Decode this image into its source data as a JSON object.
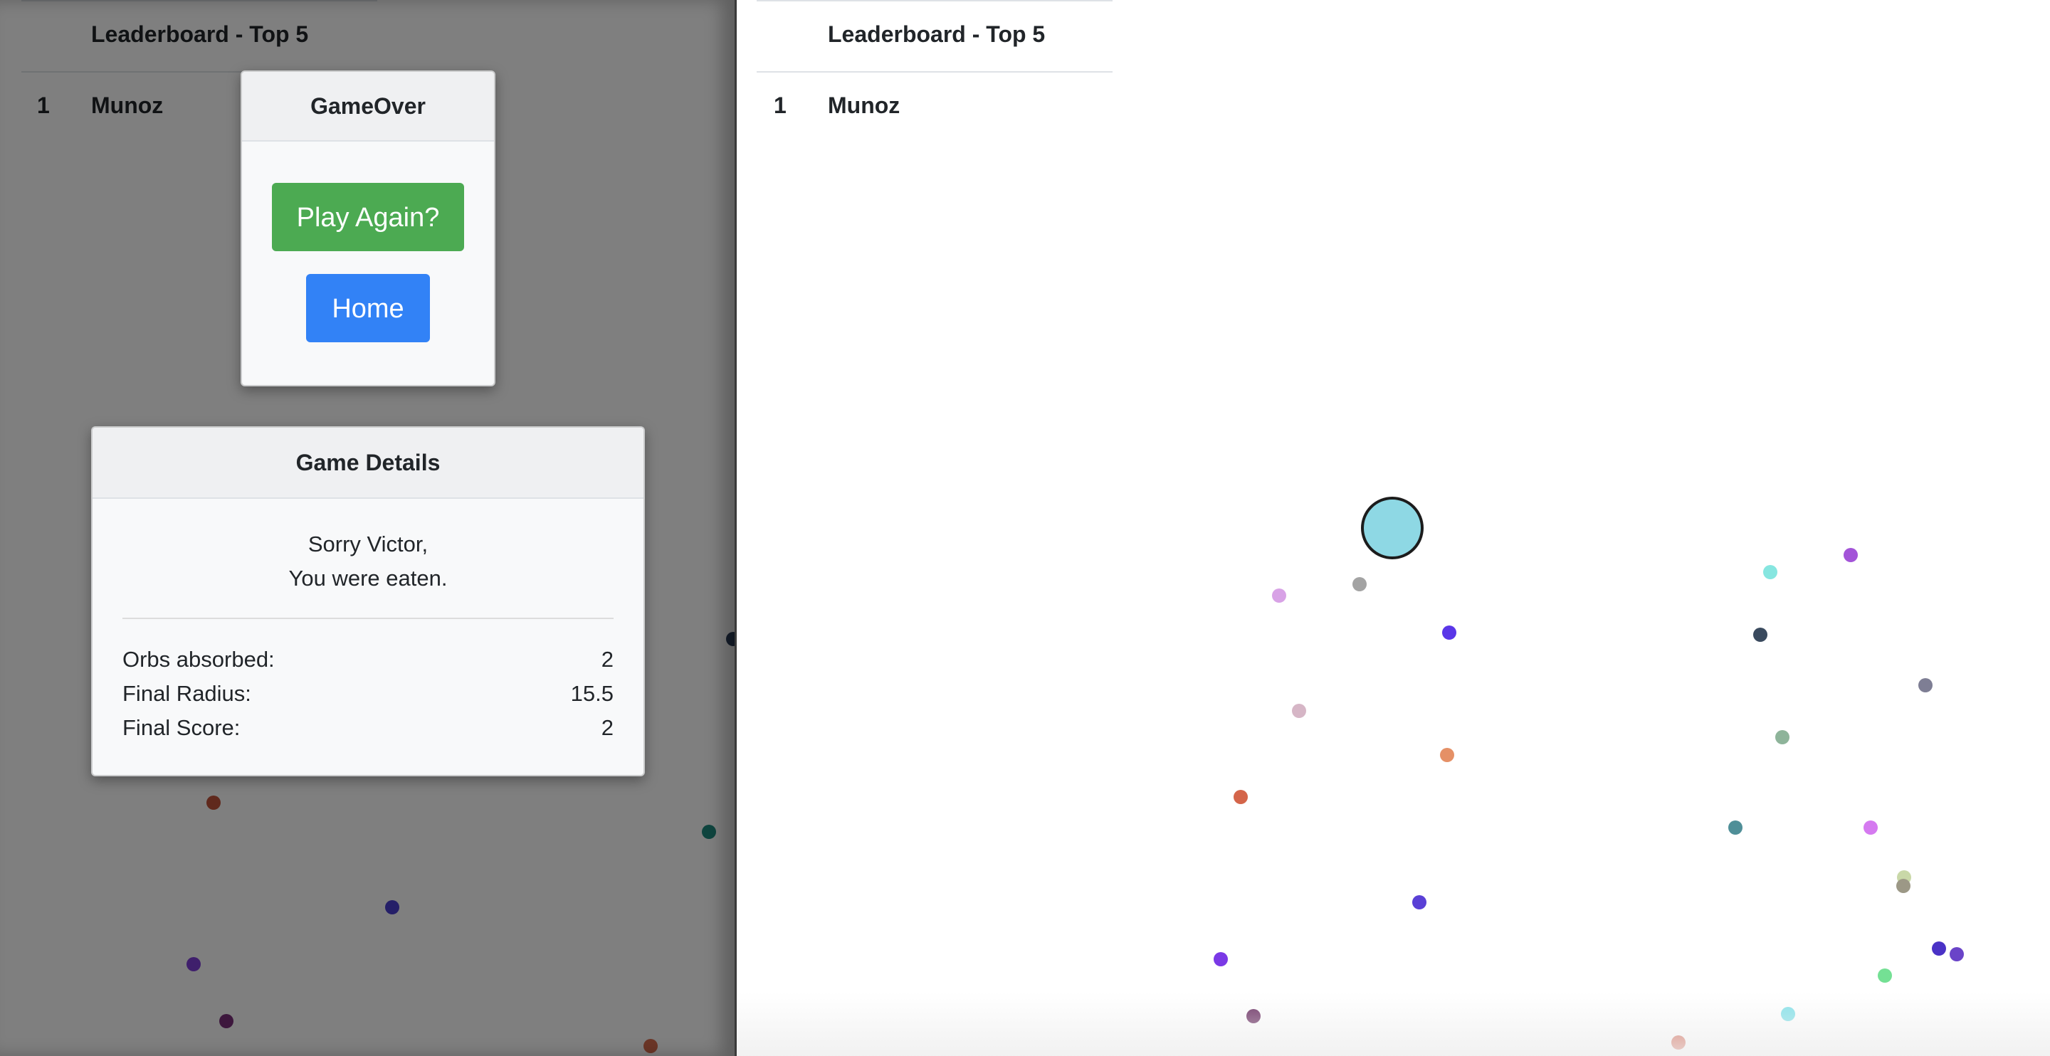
{
  "leaderboard": {
    "title": "Leaderboard - Top 5",
    "entries": [
      {
        "rank": "1",
        "name": "Munoz"
      }
    ]
  },
  "gameover": {
    "title": "GameOver",
    "play_again_label": "Play Again?",
    "home_label": "Home"
  },
  "game_details": {
    "title": "Game Details",
    "message_line1": "Sorry Victor,",
    "message_line2": "You were eaten.",
    "stats": [
      {
        "label": "Orbs absorbed:",
        "value": "2"
      },
      {
        "label": "Final Radius:",
        "value": "15.5"
      },
      {
        "label": "Final Score:",
        "value": "2"
      }
    ]
  },
  "colors": {
    "play_again": "#4caa52",
    "home": "#3282f6",
    "player": "#8ed8e4"
  }
}
